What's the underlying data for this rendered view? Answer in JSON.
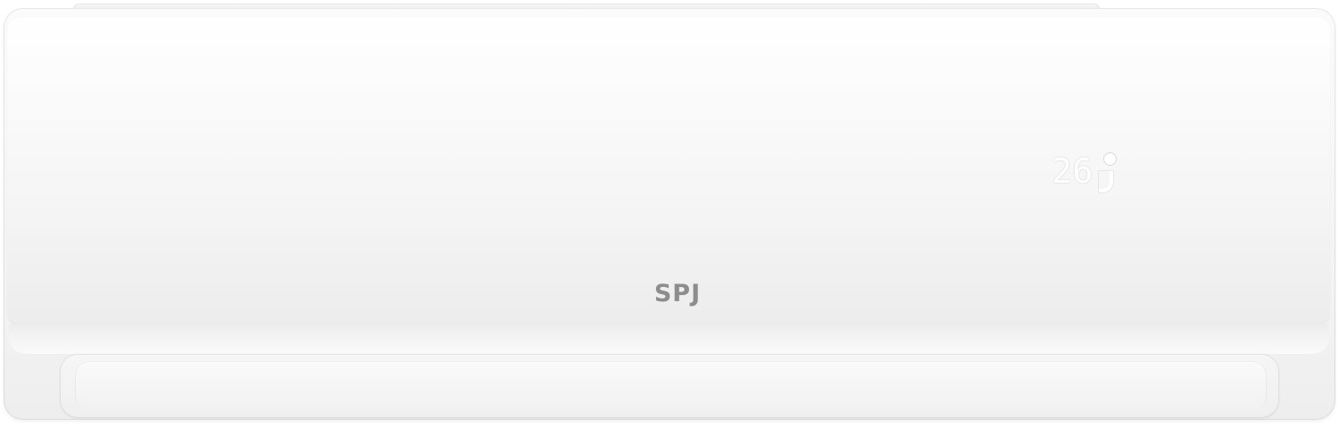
{
  "product": {
    "brand": "SPJ",
    "display": {
      "temperature": "26"
    }
  }
}
